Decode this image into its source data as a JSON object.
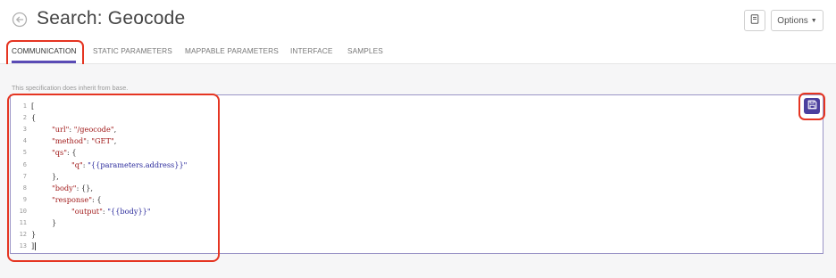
{
  "header": {
    "title": "Search: Geocode",
    "options_label": "Options",
    "back_icon": "back-arrow-icon",
    "doc_icon": "document-icon"
  },
  "tabs": [
    {
      "label": "COMMUNICATION",
      "active": true
    },
    {
      "label": "STATIC PARAMETERS",
      "active": false
    },
    {
      "label": "MAPPABLE PARAMETERS",
      "active": false
    },
    {
      "label": "INTERFACE",
      "active": false
    },
    {
      "label": "SAMPLES",
      "active": false
    }
  ],
  "inherit_note": "This specification does inherit from base.",
  "editor": {
    "line_numbers": [
      "1",
      "2",
      "3",
      "4",
      "5",
      "6",
      "7",
      "8",
      "9",
      "10",
      "11",
      "12",
      "13"
    ],
    "lines": [
      {
        "text": "["
      },
      {
        "text": "{"
      },
      {
        "key": "\"url\"",
        "sep": ": ",
        "value": "\"/geocode\"",
        "tail": ","
      },
      {
        "key": "\"method\"",
        "sep": ": ",
        "value": "\"GET\"",
        "tail": ","
      },
      {
        "key": "\"qs\"",
        "sep": ": ",
        "tail": "{"
      },
      {
        "key": "\"q\"",
        "sep": ": ",
        "value": "\"{{parameters.address}}\""
      },
      {
        "text": "},"
      },
      {
        "key": "\"body\"",
        "sep": ": ",
        "tail": "{},"
      },
      {
        "key": "\"response\"",
        "sep": ": ",
        "tail": "{"
      },
      {
        "key": "\"output\"",
        "sep": ": ",
        "value": "\"{{body}}\""
      },
      {
        "text": "}"
      },
      {
        "text": "}"
      },
      {
        "text": "]"
      }
    ]
  },
  "save_icon": "save-icon",
  "colors": {
    "accent": "#5a4bb5",
    "highlight": "#e53522",
    "save_button": "#4b3f9e",
    "json_key": "#a11a1a",
    "json_string": "#2b2b9c"
  }
}
